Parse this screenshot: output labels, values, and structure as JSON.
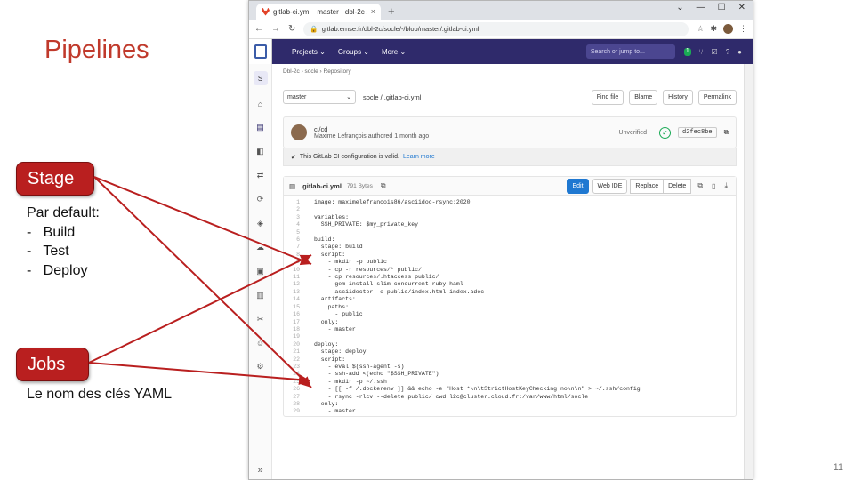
{
  "slide": {
    "title": "Pipelines",
    "page_number": "11",
    "callouts": {
      "stage": {
        "label": "Stage",
        "note_heading": "Par default:",
        "items": [
          "Build",
          "Test",
          "Deploy"
        ]
      },
      "jobs": {
        "label": "Jobs",
        "note": "Le nom des clés YAML"
      }
    }
  },
  "browser": {
    "tab_title": "gitlab-ci.yml · master · dbl-2c / …",
    "tab_close": "×",
    "new_tab": "+",
    "url": "gitlab.emse.fr/dbl-2c/socle/-/blob/master/.gitlab-ci.yml",
    "nav_icons": {
      "back": "←",
      "forward": "→",
      "reload": "↻"
    },
    "window_controls": [
      "⌄",
      "—",
      "☐",
      "✕"
    ]
  },
  "gitlab": {
    "menu": [
      "Projects ⌄",
      "Groups ⌄",
      "More ⌄"
    ],
    "search_placeholder": "Search or jump to...",
    "badge_count": "1",
    "breadcrumb": "Dbl-2c  ›  socle  ›  Repository",
    "branch": "master",
    "file_path": "socle / .gitlab-ci.yml",
    "file_buttons": [
      "Find file",
      "Blame",
      "History",
      "Permalink"
    ],
    "commit": {
      "title": "ci/cd",
      "meta": "Maxime Lefrançois authored 1 month ago",
      "status": "Unverified",
      "sha": "d2fec8be"
    },
    "validation": {
      "text": "This GitLab CI configuration is valid.",
      "link": "Learn more"
    },
    "file": {
      "name": ".gitlab-ci.yml",
      "size": "791 Bytes",
      "actions": [
        "Edit",
        "Web IDE",
        "Replace",
        "Delete"
      ]
    },
    "code_lines": [
      "image: maximelefrancois86/asciidoc-rsync:2020",
      "",
      "variables:",
      "  SSH_PRIVATE: $my_private_key",
      "",
      "build:",
      "  stage: build",
      "  script:",
      "    - mkdir -p public",
      "    - cp -r resources/* public/",
      "    - cp resources/.htaccess public/",
      "    - gem install slim concurrent-ruby haml",
      "    - asciidoctor -o public/index.html index.adoc",
      "  artifacts:",
      "    paths:",
      "      - public",
      "  only:",
      "    - master",
      "",
      "deploy:",
      "  stage: deploy",
      "  script:",
      "    - eval $(ssh-agent -s)",
      "    - ssh-add <(echo \"$SSH_PRIVATE\")",
      "    - mkdir -p ~/.ssh",
      "    - [[ -f /.dockerenv ]] && echo -e \"Host *\\n\\tStrictHostKeyChecking no\\n\\n\" > ~/.ssh/config",
      "    - rsync -rlcv --delete public/ cwd l2c@cluster.cloud.fr:/var/www/html/socle",
      "  only:",
      "    - master"
    ]
  }
}
